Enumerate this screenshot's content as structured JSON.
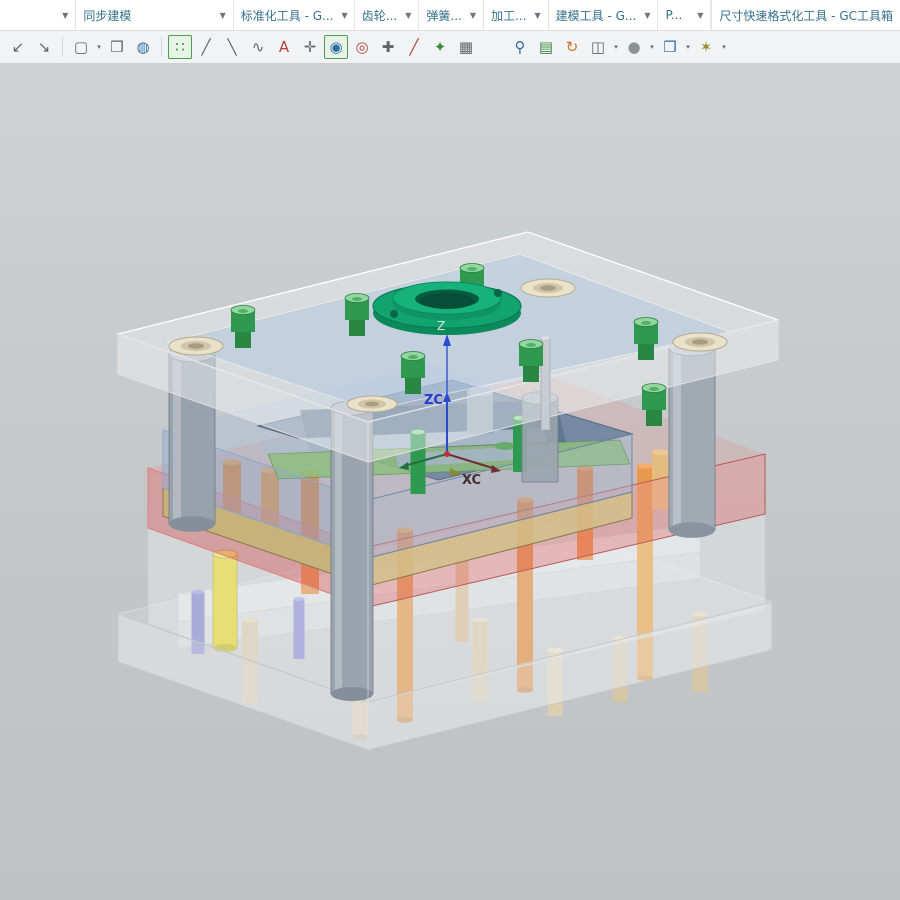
{
  "tabbar": {
    "caret_glyph": "▼",
    "items": [
      {
        "label": ""
      },
      {
        "label": "同步建模"
      },
      {
        "label": "标准化工具 - G..."
      },
      {
        "label": "齿轮..."
      },
      {
        "label": "弹簧..."
      },
      {
        "label": "加工..."
      },
      {
        "label": "建模工具 - G..."
      },
      {
        "label": "P..."
      },
      {
        "label": "尺寸快速格式化工具 - GC工具箱"
      }
    ]
  },
  "toolbar": {
    "caret_glyph": "▾",
    "icons": [
      {
        "name": "pan-arrow-icon",
        "glyph": "↙"
      },
      {
        "name": "copy-arrow-icon",
        "glyph": "↘"
      },
      {
        "name": "select-rect-icon",
        "glyph": "▢",
        "caret": true
      },
      {
        "name": "cube-icon",
        "glyph": "❒"
      },
      {
        "name": "cylinder-icon",
        "glyph": "◍"
      },
      {
        "name": "snap-point-icon",
        "glyph": "∷",
        "active": true
      },
      {
        "name": "line-icon",
        "glyph": "╱"
      },
      {
        "name": "polyline-icon",
        "glyph": "╲"
      },
      {
        "name": "spline-icon",
        "glyph": "∿"
      },
      {
        "name": "text-icon",
        "glyph": "A"
      },
      {
        "name": "datum-plane-icon",
        "glyph": "✛"
      },
      {
        "name": "circle-center-icon",
        "glyph": "◉",
        "active": true
      },
      {
        "name": "ellipse-icon",
        "glyph": "◎"
      },
      {
        "name": "point-icon",
        "glyph": "✚"
      },
      {
        "name": "sketch-line-icon",
        "glyph": "╱"
      },
      {
        "name": "wcs-dynamics-icon",
        "glyph": "✦"
      },
      {
        "name": "calculator-icon",
        "glyph": "▦"
      },
      {
        "name": "zoom-window-icon",
        "glyph": "⚲"
      },
      {
        "name": "image-icon",
        "glyph": "▤"
      },
      {
        "name": "refresh-icon",
        "glyph": "↻"
      },
      {
        "name": "window-layout-icon",
        "glyph": "◫",
        "caret": true
      },
      {
        "name": "shaded-view-icon",
        "glyph": "●",
        "caret": true
      },
      {
        "name": "orient-view-icon",
        "glyph": "❒",
        "caret": true
      },
      {
        "name": "magic-wand-icon",
        "glyph": "✶",
        "caret": true
      }
    ]
  },
  "viewport": {
    "axis_labels": {
      "z": "Z",
      "zc": "ZC",
      "xc": "XC"
    },
    "colors": {
      "ring_green": "#12a470",
      "plate_blue": "#8caacd",
      "plate_red": "#e07e7e",
      "plate_tan": "#c6b27a",
      "pillar_gray": "#98a2ac",
      "pin_orange": "#e08430",
      "pin_yellow": "#e6d616",
      "pin_purple": "#7678ca",
      "screw_green": "#2f9a4f"
    }
  }
}
